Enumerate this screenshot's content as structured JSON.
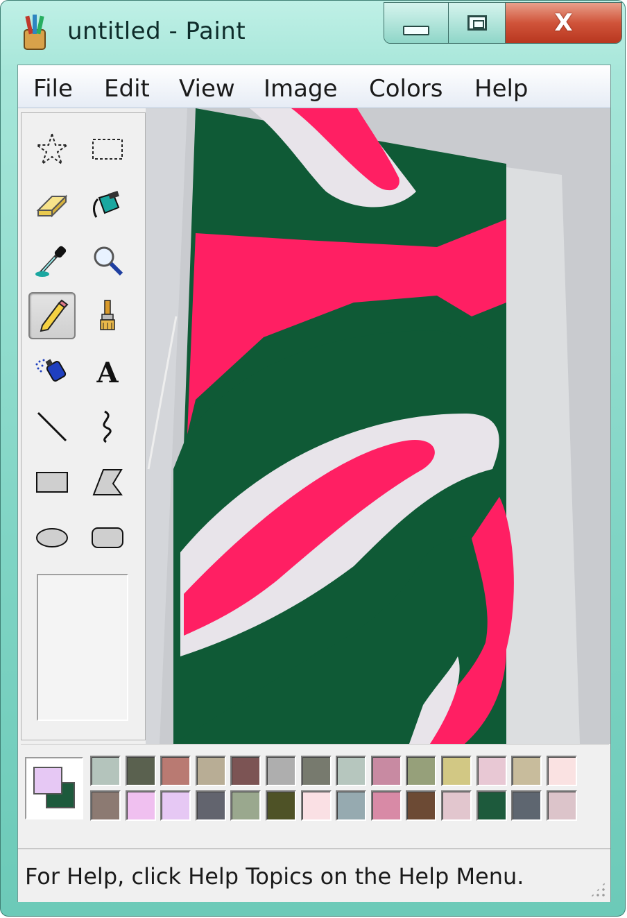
{
  "window": {
    "title": "untitled - Paint",
    "app_icon": "paint-brushes-icon",
    "caption_buttons": [
      {
        "name": "minimize",
        "icon": "minimize-icon"
      },
      {
        "name": "maximize",
        "icon": "maximize-icon"
      },
      {
        "name": "close",
        "icon": "close-icon",
        "label": "X"
      }
    ]
  },
  "menubar": {
    "items": [
      "File",
      "Edit",
      "View",
      "Image",
      "Colors",
      "Help"
    ]
  },
  "toolbox": {
    "tools": [
      {
        "name": "free-form-select",
        "icon": "star-select-icon"
      },
      {
        "name": "select",
        "icon": "rect-select-icon"
      },
      {
        "name": "eraser",
        "icon": "eraser-icon"
      },
      {
        "name": "fill-with-color",
        "icon": "paint-bucket-icon"
      },
      {
        "name": "pick-color",
        "icon": "eyedropper-icon"
      },
      {
        "name": "magnifier",
        "icon": "magnifier-icon"
      },
      {
        "name": "pencil",
        "icon": "pencil-icon",
        "active": true
      },
      {
        "name": "brush",
        "icon": "brush-icon"
      },
      {
        "name": "airbrush",
        "icon": "airbrush-icon"
      },
      {
        "name": "text",
        "icon": "text-icon",
        "glyph": "A"
      },
      {
        "name": "line",
        "icon": "line-icon"
      },
      {
        "name": "curve",
        "icon": "curve-icon"
      },
      {
        "name": "rectangle",
        "icon": "rectangle-icon"
      },
      {
        "name": "polygon",
        "icon": "polygon-icon"
      },
      {
        "name": "ellipse",
        "icon": "ellipse-icon"
      },
      {
        "name": "rounded-rectangle",
        "icon": "rounded-rectangle-icon"
      }
    ]
  },
  "canvas": {
    "content": "painting-image",
    "colors": {
      "green": "#0f5a36",
      "pink": "#ff1f63",
      "white": "#e8e4ea",
      "wall": "#d4d6da",
      "board": "#d9dbdd"
    }
  },
  "palette": {
    "foreground": "#e6c8f4",
    "background": "#1d5a3c",
    "row1": [
      "#b4c4bc",
      "#5a614f",
      "#b97a72",
      "#b8ad95",
      "#7c5454",
      "#aeaeae",
      "#777a6e",
      "#b6c6be",
      "#c88aa2",
      "#96a07a",
      "#d2c884",
      "#e8c8d4",
      "#c8bc9c",
      "#fae2e2"
    ],
    "row2": [
      "#8c7a72",
      "#f0c0f0",
      "#e6c8f4",
      "#62646e",
      "#9aa88e",
      "#4e5226",
      "#fae0e4",
      "#96aab0",
      "#d88aa6",
      "#6c4a34",
      "#e2c6ce",
      "#1d5a3c",
      "#5e6670",
      "#dcc4ca"
    ]
  },
  "statusbar": {
    "text": "For Help, click Help Topics on the Help Menu."
  }
}
